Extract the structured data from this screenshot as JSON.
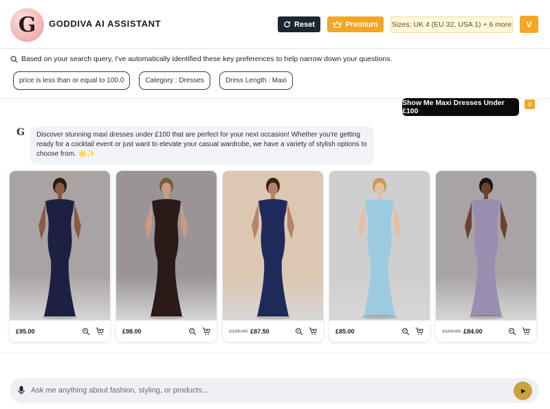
{
  "header": {
    "logo_letter": "G",
    "brand": "GODDIVA AI ASSISTANT",
    "reset_label": "Reset",
    "premium_label": "Premium",
    "sizes_text": "Sizes: UK 4 (EU 32, USA 1) + 6 more",
    "user_initial": "V"
  },
  "preferences": {
    "intro": "Based on your search query, I've automatically identified these key preferences to help narrow down your questions.",
    "chips": [
      "price is less than or equal to 100.0",
      "Category : Dresses",
      "Dress Length : Maxi"
    ]
  },
  "chat": {
    "user_message": "Show Me Maxi Dresses Under £100",
    "user_initial": "V",
    "bot_icon_letter": "G",
    "bot_message": "Discover stunning maxi dresses under £100 that are perfect for your next occasion! Whether you're getting ready for a cocktail event or just want to elevate your casual wardrobe, we have a variety of stylish options to choose from. 🌟✨"
  },
  "products": [
    {
      "old_price": "",
      "price": "£95.00",
      "bg": "#a9a3a4",
      "dress": "#1c2144",
      "skin": "#8a5a44",
      "hair": "#2a1a14"
    },
    {
      "old_price": "",
      "price": "£98.00",
      "bg": "#9a9496",
      "dress": "#2a1a18",
      "skin": "#c99b82",
      "hair": "#7a5a3c"
    },
    {
      "old_price": "£125.00",
      "price": "£87.50",
      "bg": "#dcc7b3",
      "dress": "#1d2a5a",
      "skin": "#b5846a",
      "hair": "#3a2418"
    },
    {
      "old_price": "",
      "price": "£85.00",
      "bg": "#cfcfcf",
      "dress": "#9ccbe0",
      "skin": "#e3c0a5",
      "hair": "#c89a5a"
    },
    {
      "old_price": "£120.00",
      "price": "£84.00",
      "bg": "#a8a4a6",
      "dress": "#9a8eb0",
      "skin": "#6a4330",
      "hair": "#1e140f"
    }
  ],
  "composer": {
    "placeholder": "Ask me anything about fashion, styling, or products..."
  },
  "colors": {
    "accent": "#f5a623",
    "dark": "#1d2530",
    "send": "#c9a23a"
  }
}
